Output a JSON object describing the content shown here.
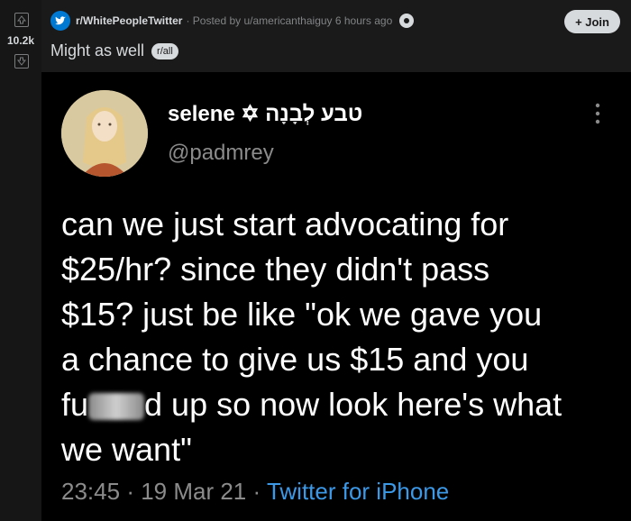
{
  "vote": {
    "score": "10.2k"
  },
  "post": {
    "subreddit": "r/WhitePeopleTwitter",
    "meta": "· Posted by u/americanthaiguy 6 hours ago",
    "join_label": "+ Join",
    "title": "Might as well",
    "flair": "r/all"
  },
  "tweet": {
    "display_name": "selene ✡ טבע לְבָנָה",
    "handle": "@padmrey",
    "lines": [
      "can we just start advocating for",
      "$25/hr? since they didn't pass",
      "$15? just be like \"ok we gave you",
      "a chance to give us $15 and you"
    ],
    "line5_start": "fu",
    "line5_end": "d up so now look here's what",
    "line6": "we want\"",
    "time": "23:45",
    "date": "19 Mar 21",
    "source": "Twitter for iPhone"
  }
}
